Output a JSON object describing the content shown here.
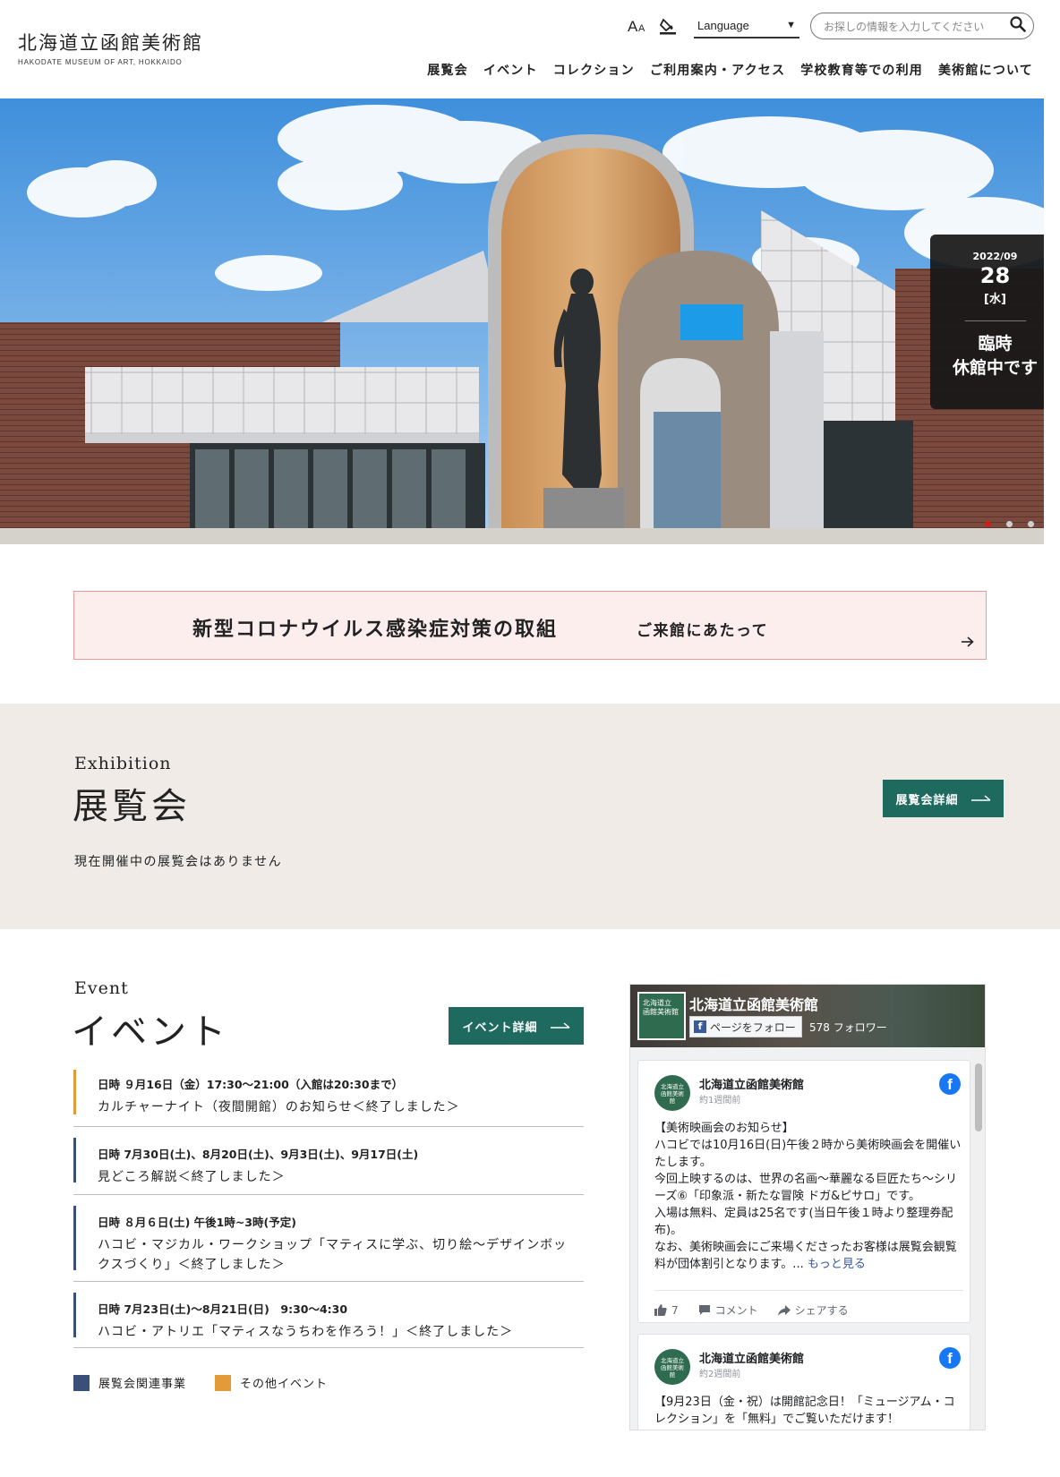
{
  "header": {
    "logo_jp": "北海道立函館美術館",
    "logo_en": "HAKODATE MUSEUM OF ART, HOKKAIDO",
    "font_size_icon": "font-size-icon",
    "contrast_icon": "color-contrast-icon",
    "language_label": "Language",
    "search_placeholder": "お探しの情報を入力してください",
    "nav": [
      "展覧会",
      "イベント",
      "コレクション",
      "ご利用案内・アクセス",
      "学校教育等での利用",
      "美術館について"
    ]
  },
  "hero": {
    "date": "2022/09",
    "day": "28",
    "weekday": "[水]",
    "message_line1": "臨時",
    "message_line2": "休館中です",
    "slides_total": 3,
    "active_slide": 1
  },
  "corona": {
    "title": "新型コロナウイルス感染症対策の取組",
    "subtitle": "ご来館にあたって"
  },
  "exhibition": {
    "heading_en": "Exhibition",
    "heading_jp": "展覧会",
    "button_label": "展覧会詳細",
    "empty_message": "現在開催中の展覧会はありません"
  },
  "events": {
    "heading_en": "Event",
    "heading_jp": "イベント",
    "button_label": "イベント詳細",
    "items": [
      {
        "date": "日時 ９月16日（金）17:30～21:00（入館は20:30まで）",
        "title": "カルチャーナイト（夜間開館）のお知らせ＜終了しました＞",
        "category": "other"
      },
      {
        "date": "日時 7月30日(土)、8月20日(土)、9月3日(土)、9月17日(土)",
        "title": "見どころ解説＜終了しました＞",
        "category": "exhibition"
      },
      {
        "date": "日時 ８月６日(土) 午後1時~3時(予定)",
        "title": "ハコビ・マジカル・ワークショップ「マティスに学ぶ、切り絵～デザインボックスづくり」＜終了しました＞",
        "category": "exhibition"
      },
      {
        "date": "日時 7月23日(土)～8月21日(日)　9:30～4:30",
        "title": "ハコビ・アトリエ「マティスなうちわを作ろう！」＜終了しました＞",
        "category": "exhibition"
      }
    ],
    "legend": [
      {
        "label": "展覧会関連事業",
        "color": "#3a5078"
      },
      {
        "label": "その他イベント",
        "color": "#e39b3a"
      }
    ]
  },
  "facebook": {
    "page_name": "北海道立函館美術館",
    "thumb_text": "北海道立 函館美術館",
    "follow_label": "ページをフォロー",
    "followers": "578 フォロワー",
    "posts": [
      {
        "author": "北海道立函館美術館",
        "time": "約1週間前",
        "text": "【美術映画会のお知らせ】\nハコビでは10月16日(日)午後２時から美術映画会を開催いたします。\n今回上映するのは、世界の名画～華麗なる巨匠たち～シリーズ⑥「印象派・新たな冒険 ドガ&ピサロ」です。\n入場は無料、定員は25名です(当日午後１時より整理券配布)。\nなお、美術映画会にご来場くださったお客様は展覧会観覧料が団体割引となります。...",
        "more": "もっと見る",
        "likes": "7",
        "comment": "コメント",
        "share": "シェアする"
      },
      {
        "author": "北海道立函館美術館",
        "time": "約2週間前",
        "text": "【9月23日（金・祝）は開館記念日！「ミュージアム・コレクション」を「無料」でご覧いただけます！"
      }
    ]
  },
  "colors": {
    "accent_green": "#1f6a5f",
    "exhibition_bg": "#f0ebe6",
    "corona_bg": "#fdeeee",
    "corona_border": "#e89a9a",
    "closed_badge": "#181818",
    "slide_active": "#c92020"
  }
}
